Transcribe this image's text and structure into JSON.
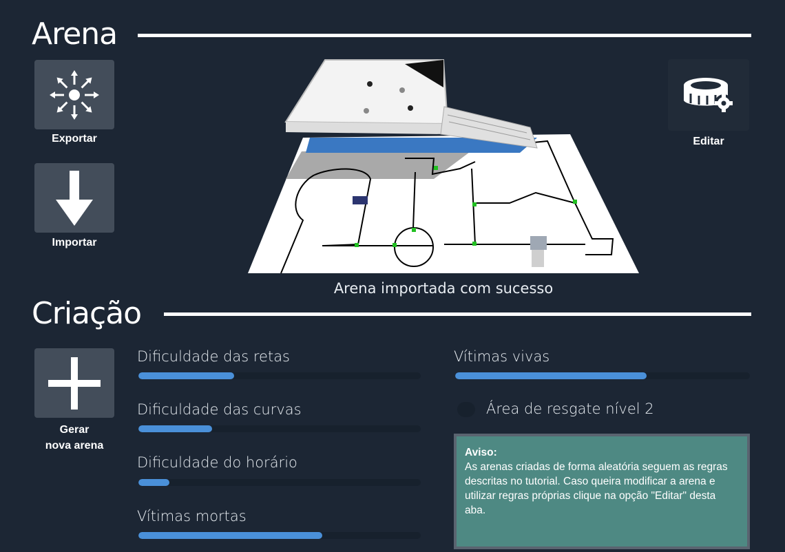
{
  "arena_section": {
    "title": "Arena"
  },
  "creation_section": {
    "title": "Criação"
  },
  "actions": {
    "export_label": "Exportar",
    "import_label": "Importar",
    "edit_label": "Editar",
    "generate_label_line1": "Gerar",
    "generate_label_line2": "nova arena"
  },
  "status": {
    "message": "Arena importada com sucesso"
  },
  "sliders": [
    {
      "label": "Dificuldade das retas",
      "value": 0.34
    },
    {
      "label": "Dificuldade das curvas",
      "value": 0.26
    },
    {
      "label": "Dificuldade do horário",
      "value": 0.11
    },
    {
      "label": "Vítimas mortas",
      "value": 0.65
    },
    {
      "label": "Vítimas vivas",
      "value": 0.65
    }
  ],
  "rescue_toggle": {
    "label": "Área de resgate nível 2",
    "checked": false
  },
  "notice": {
    "title": "Aviso:",
    "body": "As arenas criadas de forma aleatória seguem as regras descritas no tutorial. Caso queira modificar a arena e utilizar regras próprias clique na opção \"Editar\" desta aba."
  },
  "colors": {
    "background": "#1c2634",
    "tile": "#434d5a",
    "slider_fill": "#4a90d9",
    "notice_bg": "#4e8983"
  },
  "icons": {
    "export": "export-arrows-icon",
    "import": "download-arrow-icon",
    "edit": "stadium-gear-icon",
    "generate": "plus-icon"
  }
}
